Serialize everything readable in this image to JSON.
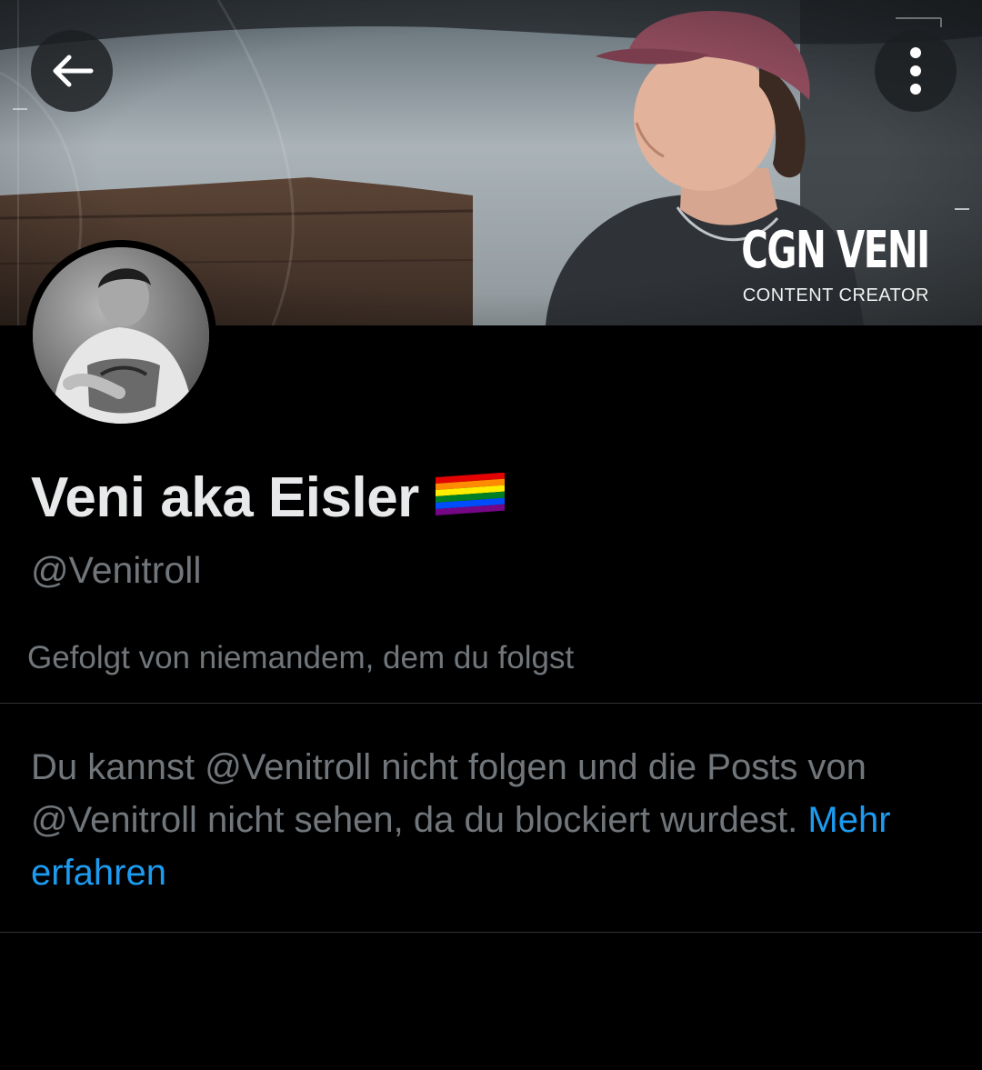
{
  "banner": {
    "brand_title": "CGN VENI",
    "brand_subtitle": "CONTENT CREATOR"
  },
  "toolbar": {
    "back_icon": "arrow-left-icon",
    "more_icon": "more-vertical-icon"
  },
  "profile": {
    "display_name": "Veni aka Eisler",
    "name_emoji": "rainbow-flag",
    "handle": "@Venitroll",
    "followed_by": "Gefolgt von niemandem, dem du folgst"
  },
  "blocked": {
    "message": "Du kannst @Venitroll nicht folgen und die Posts von @Venitroll nicht sehen, da du blockiert wurdest. ",
    "learn_more": "Mehr erfahren"
  },
  "colors": {
    "background": "#000000",
    "primary_text": "#e7e9ea",
    "secondary_text": "#71767b",
    "link": "#1d9bf0",
    "divider": "#2f3336"
  }
}
